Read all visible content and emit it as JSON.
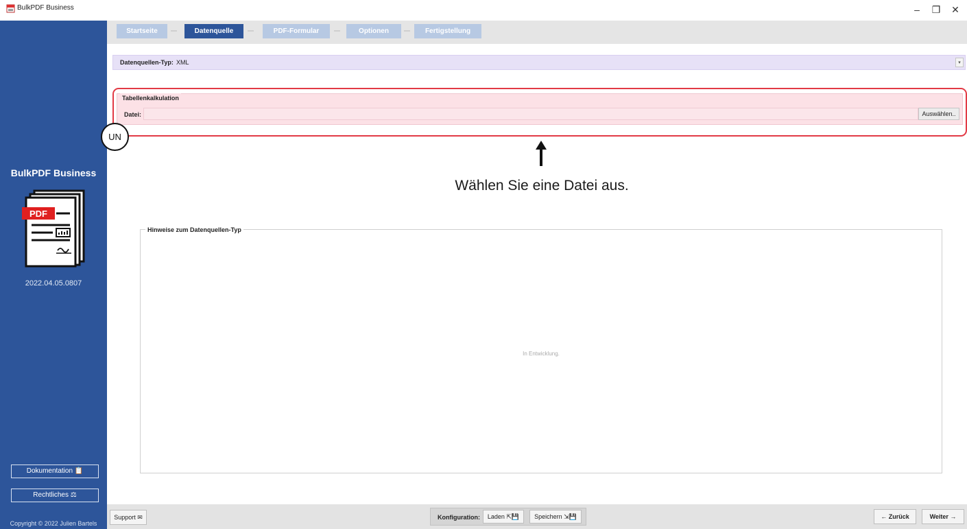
{
  "window": {
    "title": "BulkPDF Business",
    "minimize_glyph": "–",
    "maximize_glyph": "❐",
    "close_glyph": "✕"
  },
  "sidebar": {
    "brand": "BulkPDF Business",
    "logo_label": "PDF",
    "version": "2022.04.05.0807",
    "documentation_label": "Dokumentation 📋",
    "legal_label": "Rechtliches ⚖",
    "copyright": "Copyright © 2022 Julien Bartels"
  },
  "steps": [
    "Startseite",
    "Datenquelle",
    "PDF-Formular",
    "Optionen",
    "Fertigstellung"
  ],
  "datasource": {
    "type_label": "Datenquellen-Typ:",
    "type_value": "XML",
    "dropdown_glyph": "▾"
  },
  "spreadsheet": {
    "legend": "Tabellenkalkulation",
    "file_label": "Datei:",
    "file_value": "",
    "choose_label": "Auswählen.."
  },
  "annotation": {
    "badge": "UN",
    "callout": "Wählen Sie eine Datei aus."
  },
  "hints": {
    "legend": "Hinweise zum Datenquellen-Typ",
    "body": "In Entwicklung."
  },
  "footer": {
    "support_label": "Support ✉",
    "config_label": "Konfiguration:",
    "load_label": "Laden ⇱💾",
    "save_label": "Speichern ⇲💾",
    "back_label": "← Zurück",
    "next_label": "Weiter →"
  },
  "colors": {
    "sidebar": "#2d559a",
    "step_active": "#2d559a",
    "step_inactive": "#b7c9e3",
    "highlight_border": "#e23a45",
    "datasource_bar": "#e7e1f7",
    "spreadsheet_group": "#fce1e6"
  }
}
